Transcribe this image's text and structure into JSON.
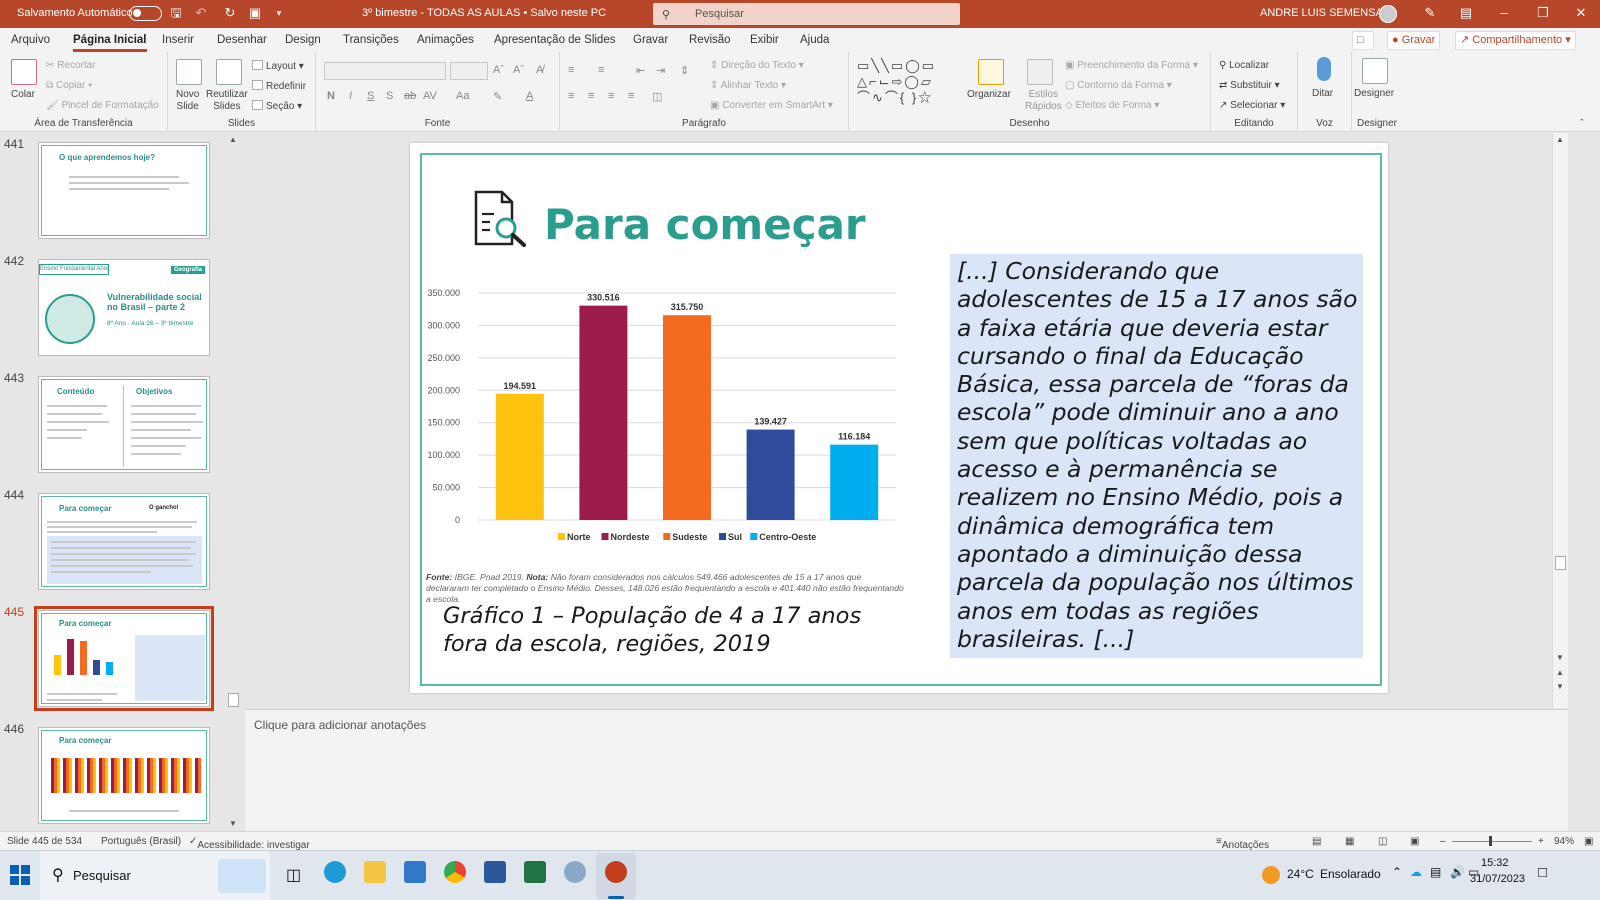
{
  "titlebar": {
    "autosave_label": "Salvamento Automático",
    "doc_title": "3º bimestre - TODAS AS AULAS • Salvo neste PC",
    "search_placeholder": "Pesquisar",
    "user_name": "ANDRE LUIS SEMENSATO",
    "bar_color": "#b7472a"
  },
  "menu": {
    "tabs": [
      "Arquivo",
      "Página Inicial",
      "Inserir",
      "Desenhar",
      "Design",
      "Transições",
      "Animações",
      "Apresentação de Slides",
      "Gravar",
      "Revisão",
      "Exibir",
      "Ajuda"
    ],
    "active_tab": "Página Inicial",
    "record_button": "Gravar",
    "share_button": "Compartilhamento"
  },
  "ribbon": {
    "clipboard": {
      "paste": "Colar",
      "cut": "Recortar",
      "copy": "Copiar",
      "format_painter": "Pincel de Formatação",
      "label": "Área de Transferência"
    },
    "slides": {
      "new_slide": "Novo",
      "new_slide2": "Slide",
      "reuse": "Reutilizar",
      "reuse2": "Slides",
      "layout": "Layout",
      "reset": "Redefinir",
      "section": "Seção",
      "label": "Slides"
    },
    "font": {
      "label": "Fonte"
    },
    "paragraph": {
      "text_direction": "Direção do Texto",
      "align_text": "Alinhar Texto",
      "smartart": "Converter em SmartArt",
      "label": "Parágrafo"
    },
    "drawing": {
      "arrange": "Organizar",
      "quick_styles": "Estilos",
      "quick_styles2": "Rápidos",
      "shape_fill": "Preenchimento da Forma",
      "shape_outline": "Contorno da Forma",
      "shape_effects": "Efeitos de Forma",
      "label": "Desenho"
    },
    "editing": {
      "find": "Localizar",
      "replace": "Substituir",
      "select": "Selecionar",
      "label": "Editando"
    },
    "voice": {
      "dictate": "Ditar",
      "label": "Voz"
    },
    "designer": {
      "designer": "Designer",
      "label": "Designer"
    }
  },
  "thumbnails": [
    {
      "number": "441",
      "title": "O que aprendemos hoje?"
    },
    {
      "number": "442",
      "title": "Vulnerabilidade social no Brasil – parte 2",
      "subject": "Geografia",
      "meta": "Ensino Fundamental Anos Finais",
      "info": "8º Ano · Aula 26 – 3º bimestre"
    },
    {
      "number": "443",
      "title": "Conteúdo",
      "title2": "Objetivos"
    },
    {
      "number": "444",
      "title": "Para começar",
      "title2": "O gancho!"
    },
    {
      "number": "445",
      "title": "Para começar"
    },
    {
      "number": "446",
      "title": "Para começar"
    }
  ],
  "slide": {
    "title": "Para começar",
    "title_color": "#2a9d8f",
    "quote": "[...] Considerando que adolescentes de 15 a 17 anos são a faixa etária que deveria estar cursando o final da Educação Básica, essa parcela de “foras da escola” pode diminuir ano a ano sem que políticas voltadas ao acesso e à permanência se realizem no Ensino Médio, pois a dinâmica demográfica tem apontado a diminuição dessa parcela da população nos últimos anos em todas as regiões brasileiras. [...]",
    "caption": "Gráfico 1 – População de 4 a 17 anos fora da escola, regiões, 2019",
    "source_label": "Fonte:",
    "source_text": "IBGE. Pnad 2019.",
    "note_label": "Nota:",
    "note_text": "Não foram considerados nos cálculos 549.466 adolescentes de 15 a 17 anos que declararam ter completado o Ensino Médio. Desses, 148.026 estão frequentando a escola e 401.440 não estão frequentando a escola."
  },
  "chart_data": {
    "type": "bar",
    "categories": [
      "Norte",
      "Nordeste",
      "Sudeste",
      "Sul",
      "Centro-Oeste"
    ],
    "values": [
      194591,
      330516,
      315750,
      139427,
      116184
    ],
    "value_labels": [
      "194.591",
      "330.516",
      "315.750",
      "139.427",
      "116.184"
    ],
    "colors": [
      "#ffc20e",
      "#9b1b4a",
      "#f26b21",
      "#2e4c9b",
      "#00aeef"
    ],
    "ylim": [
      0,
      350000
    ],
    "yticks": [
      "0",
      "50.000",
      "100.000",
      "150.000",
      "200.000",
      "250.000",
      "300.000",
      "350.000"
    ],
    "grid": true,
    "legend": "bottom"
  },
  "notes": {
    "placeholder": "Clique para adicionar anotações"
  },
  "statusbar": {
    "slide_info": "Slide 445 de 534",
    "language": "Português (Brasil)",
    "accessibility": "Acessibilidade: investigar",
    "notes": "Anotações",
    "zoom": "94%"
  },
  "taskbar": {
    "search": "Pesquisar",
    "weather_temp": "24°C",
    "weather_text": "Ensolarado",
    "time": "15:32",
    "date": "31/07/2023"
  }
}
